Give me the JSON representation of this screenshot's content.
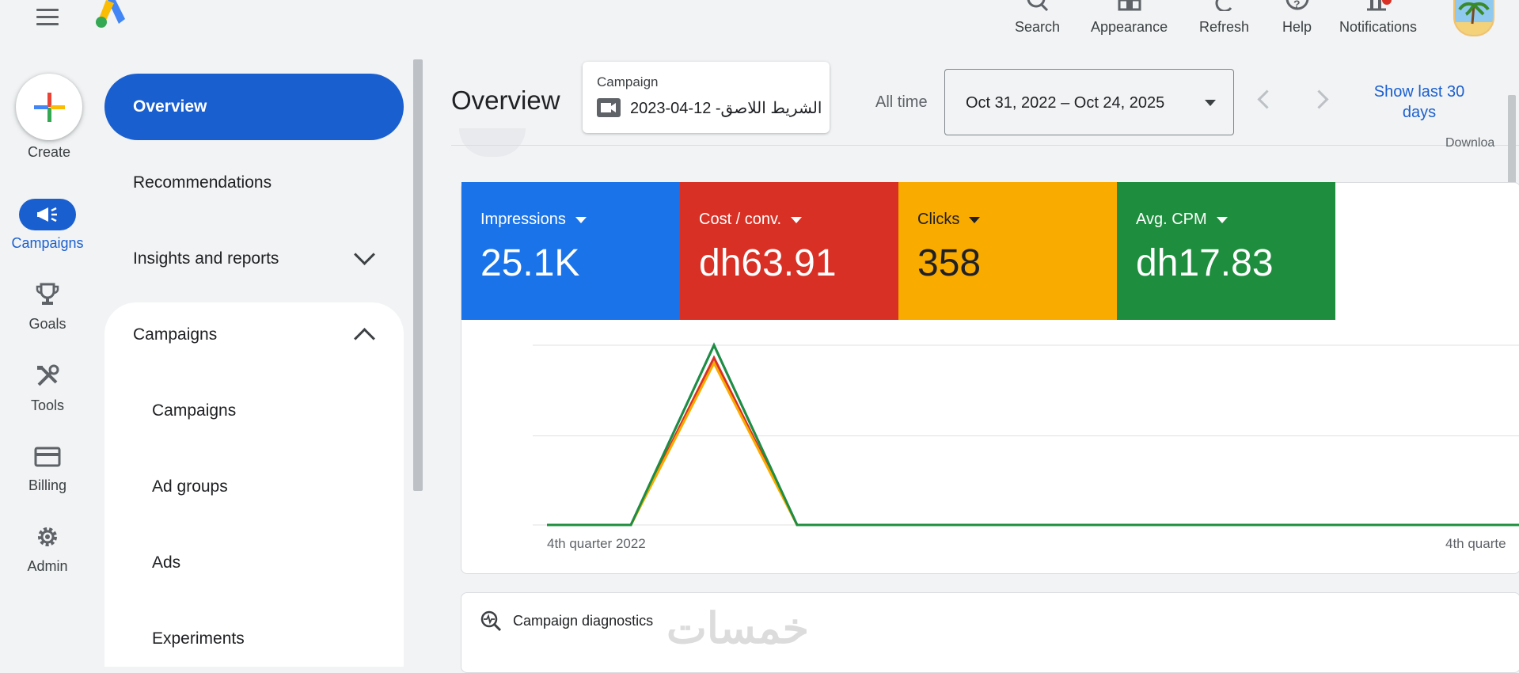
{
  "topbar": {
    "actions": [
      {
        "label": "Search",
        "icon": "search-icon"
      },
      {
        "label": "Appearance",
        "icon": "appearance-icon"
      },
      {
        "label": "Refresh",
        "icon": "refresh-icon"
      },
      {
        "label": "Help",
        "icon": "help-icon"
      },
      {
        "label": "Notifications",
        "icon": "notifications-icon"
      }
    ]
  },
  "rail": {
    "create": "Create",
    "campaigns": "Campaigns",
    "goals": "Goals",
    "tools": "Tools",
    "billing": "Billing",
    "admin": "Admin"
  },
  "nav": {
    "overview": "Overview",
    "recommendations": "Recommendations",
    "insights": "Insights and reports",
    "campaigns_section": "Campaigns",
    "sub_items": [
      "Campaigns",
      "Ad groups",
      "Ads",
      "Experiments"
    ]
  },
  "header": {
    "title": "Overview",
    "campaign_caption": "Campaign",
    "campaign_value": "الشريط اللاصق- 12-04-2023",
    "all_time": "All time",
    "date_range": "Oct 31, 2022 – Oct 24, 2025",
    "show_last": "Show last 30 days",
    "download_partial": "Downloa"
  },
  "metrics": [
    {
      "label": "Impressions",
      "value": "25.1K",
      "color": "#1a73e8"
    },
    {
      "label": "Cost / conv.",
      "value": "dh63.91",
      "color": "#d93025"
    },
    {
      "label": "Clicks",
      "value": "358",
      "color": "#f9ab00"
    },
    {
      "label": "Avg. CPM",
      "value": "dh17.83",
      "color": "#1e8e3e"
    }
  ],
  "chart_data": {
    "type": "line",
    "x_labels": [
      "4th quarter 2022",
      "4th quarte"
    ],
    "series": [
      {
        "color": "#1a73e8",
        "values": [
          0,
          0,
          1.0,
          0,
          0,
          0,
          0,
          0,
          0,
          0,
          0,
          0
        ]
      },
      {
        "color": "#d93025",
        "values": [
          0,
          0,
          0.93,
          0,
          0,
          0,
          0,
          0,
          0,
          0,
          0,
          0
        ]
      },
      {
        "color": "#f9ab00",
        "values": [
          0,
          0,
          0.9,
          0,
          0,
          0,
          0,
          0,
          0,
          0,
          0,
          0
        ]
      },
      {
        "color": "#1e8e3e",
        "values": [
          0,
          0,
          1.0,
          0,
          0,
          0,
          0,
          0,
          0,
          0,
          0,
          0
        ]
      }
    ],
    "grid": true
  },
  "diagnostics": {
    "label": "Campaign diagnostics",
    "watermark": "خمسات"
  }
}
